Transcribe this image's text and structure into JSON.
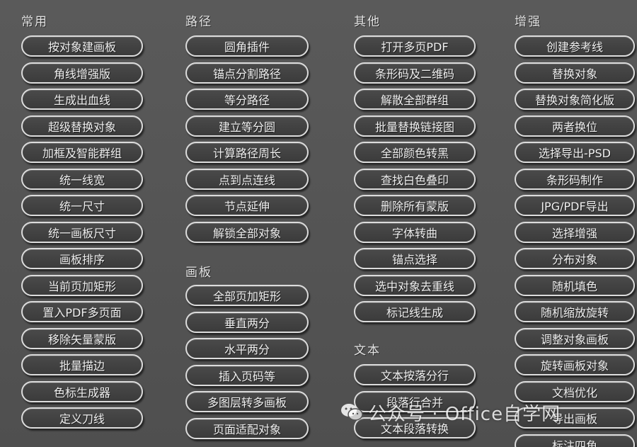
{
  "sections": {
    "common": {
      "title": "常用",
      "buttons": [
        "按对象建画板",
        "角线增强版",
        "生成出血线",
        "超级替换对象",
        "加框及智能群组",
        "统一线宽",
        "统一尺寸",
        "统一画板尺寸",
        "画板排序",
        "当前页加矩形",
        "置入PDF多页面",
        "移除矢量蒙版",
        "批量描边",
        "色标生成器",
        "定义刀线"
      ]
    },
    "path": {
      "title": "路径",
      "buttons": [
        "圆角插件",
        "锚点分割路径",
        "等分路径",
        "建立等分圆",
        "计算路径周长",
        "点到点连线",
        "节点延伸",
        "解锁全部对象"
      ]
    },
    "artboard": {
      "title": "画板",
      "buttons": [
        "全部页加矩形",
        "垂直两分",
        "水平两分",
        "插入页码等",
        "多图层转多画板",
        "页面适配对象"
      ]
    },
    "other": {
      "title": "其他",
      "buttons": [
        "打开多页PDF",
        "条形码及二维码",
        "解散全部群组",
        "批量替换链接图",
        "全部颜色转黑",
        "查找白色叠印",
        "删除所有蒙版",
        "字体转曲",
        "锚点选择",
        "选中对象去重线",
        "标记线生成"
      ]
    },
    "text": {
      "title": "文本",
      "buttons": [
        "文本按落分行",
        "段落行合并",
        "文本段落转换"
      ]
    },
    "enhance": {
      "title": "增强",
      "buttons": [
        "创建参考线",
        "替换对象",
        "替换对象简化版",
        "两者换位",
        "选择导出-PSD",
        "条形码制作",
        "JPG/PDF导出",
        "选择增强",
        "分布对象",
        "随机填色",
        "随机缩放旋转",
        "调整对象画板",
        "旋转画板对象",
        "文档优化",
        "导出画板",
        "标注四角"
      ]
    }
  },
  "watermark": {
    "text": "公众号 · Office自学网",
    "icon": "wechat-icon"
  },
  "colors": {
    "background": "#525252",
    "button_border": "#dcdcdc",
    "text": "#f0f0f0"
  }
}
